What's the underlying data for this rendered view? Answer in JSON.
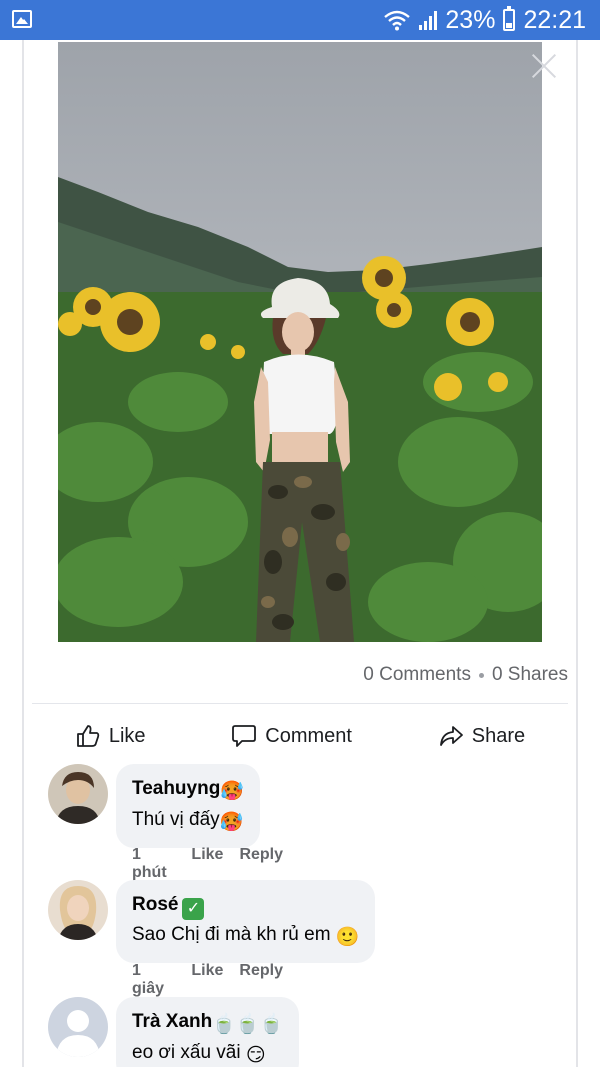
{
  "status_bar": {
    "battery_percent": "23%",
    "time": "22:21",
    "icons": [
      "gallery-icon",
      "wifi-icon",
      "signal-icon",
      "battery-icon"
    ]
  },
  "post": {
    "photo_description_icon": "post-photo",
    "comments_count": "0 Comments",
    "shares_count": "0 Shares",
    "actions": {
      "like": "Like",
      "comment": "Comment",
      "share": "Share"
    }
  },
  "comments": [
    {
      "name": "Teahuyng",
      "name_emoji": "🥵",
      "text": "Thú vị đấy",
      "text_emoji": "🥵",
      "time": "1 phút trước",
      "like": "Like",
      "reply": "Reply"
    },
    {
      "name": "Rosé",
      "name_emoji": "✓",
      "text": "Sao Chị đi mà kh rủ em",
      "text_emoji": "🙂",
      "time": "1 giây trước",
      "like": "Like",
      "reply": "Reply"
    },
    {
      "name": "Trà Xanh",
      "name_emoji": "🍵🍵🍵",
      "text": "eo ơi xấu vãi",
      "text_emoji": "😏"
    }
  ],
  "colors": {
    "status_bar": "#3b76d6",
    "bubble": "#f0f2f5",
    "meta_text": "#65676b"
  }
}
